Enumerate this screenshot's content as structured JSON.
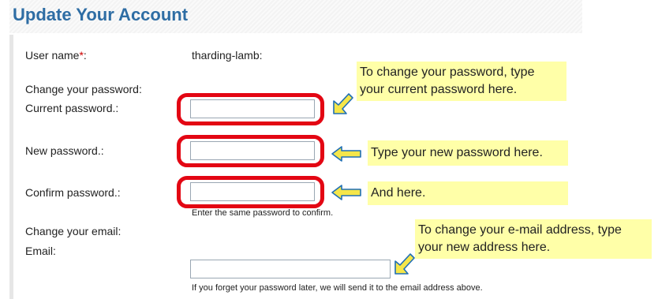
{
  "page": {
    "title": "Update Your Account"
  },
  "form": {
    "username": {
      "label": "User name",
      "required_mark": "*",
      "suffix": ":",
      "value": "tharding-lamb:"
    },
    "password_section": {
      "label": "Change your password:"
    },
    "current_password": {
      "label": "Current password.:",
      "value": ""
    },
    "new_password": {
      "label": "New password.:",
      "value": ""
    },
    "confirm_password": {
      "label": "Confirm password.:",
      "value": "",
      "hint": "Enter the same password to confirm."
    },
    "email_section": {
      "label": "Change your email:"
    },
    "email": {
      "label": "Email:",
      "value": "",
      "hint": "If you forget your password later, we will send it to the email address above."
    }
  },
  "callouts": {
    "current_password": {
      "line1": "To change your password, type",
      "line2": "your current password here."
    },
    "new_password": {
      "text": "Type your new password here."
    },
    "confirm_password": {
      "text": "And here."
    },
    "email": {
      "line1": "To change your e-mail address, type",
      "line2": "your new address here."
    }
  },
  "colors": {
    "title": "#2e6da4",
    "highlight_ring": "#e30613",
    "callout_bg": "#ffffa8",
    "arrow_fill": "#f5e64a",
    "arrow_stroke": "#1f6fb5",
    "required": "#cc0000"
  },
  "icons": {
    "diagonal_arrow": "arrow-down-left-icon",
    "left_arrow": "arrow-left-icon"
  }
}
